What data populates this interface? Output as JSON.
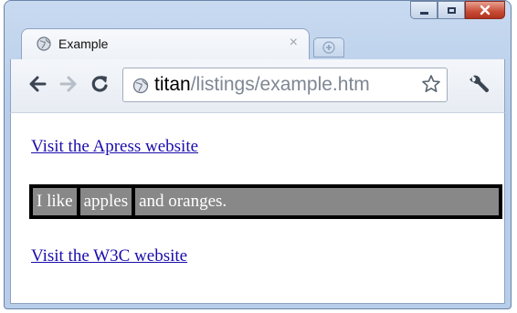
{
  "window": {
    "controls": {
      "minimize": "minimize",
      "maximize": "maximize",
      "close": "close"
    }
  },
  "tab": {
    "title": "Example",
    "close_glyph": "×",
    "favicon_icon": "globe-icon",
    "new_tab_icon": "new-tab-icon"
  },
  "toolbar": {
    "back_icon": "back-arrow-icon",
    "forward_icon": "forward-arrow-icon",
    "reload_icon": "reload-icon",
    "url_host": "titan",
    "url_path": "/listings/example.htm",
    "bookmark_icon": "star-icon",
    "menu_icon": "wrench-icon"
  },
  "content": {
    "link1": "Visit the Apress website",
    "sentence_part1": "I like",
    "sentence_part2": "apples",
    "sentence_part3": "and oranges.",
    "link2": "Visit the W3C website"
  },
  "colors": {
    "link": "#1a0dab",
    "bar_border": "#000000",
    "bar_fill": "#888888",
    "bar_text": "#ffffff"
  }
}
